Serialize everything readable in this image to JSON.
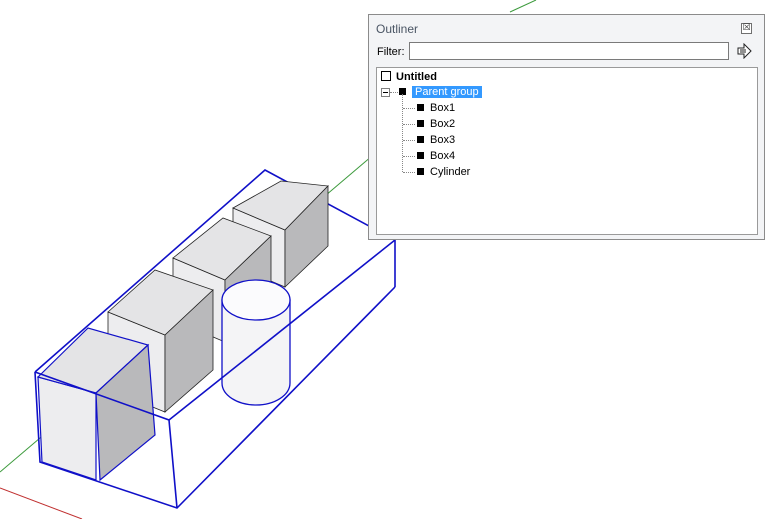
{
  "outliner": {
    "title": "Outliner",
    "close_glyph": "☒",
    "filter_label": "Filter:",
    "filter_value": "",
    "filter_placeholder": "",
    "root": {
      "label": "Untitled",
      "icon": "model-icon"
    },
    "parent_group": {
      "label": "Parent group",
      "icon": "group-icon",
      "expanded": true,
      "selected": true
    },
    "children": [
      {
        "label": "Box1",
        "icon": "group-icon"
      },
      {
        "label": "Box2",
        "icon": "group-icon"
      },
      {
        "label": "Box3",
        "icon": "group-icon"
      },
      {
        "label": "Box4",
        "icon": "group-icon"
      },
      {
        "label": "Cylinder",
        "icon": "group-icon"
      }
    ]
  },
  "colors": {
    "selection_outline": "#1010c8",
    "axis_green": "#3c9a3c",
    "axis_red": "#c03030",
    "face_light": "#eaeaec",
    "face_dark": "#b9b9bb",
    "highlight": "#3399ff"
  }
}
